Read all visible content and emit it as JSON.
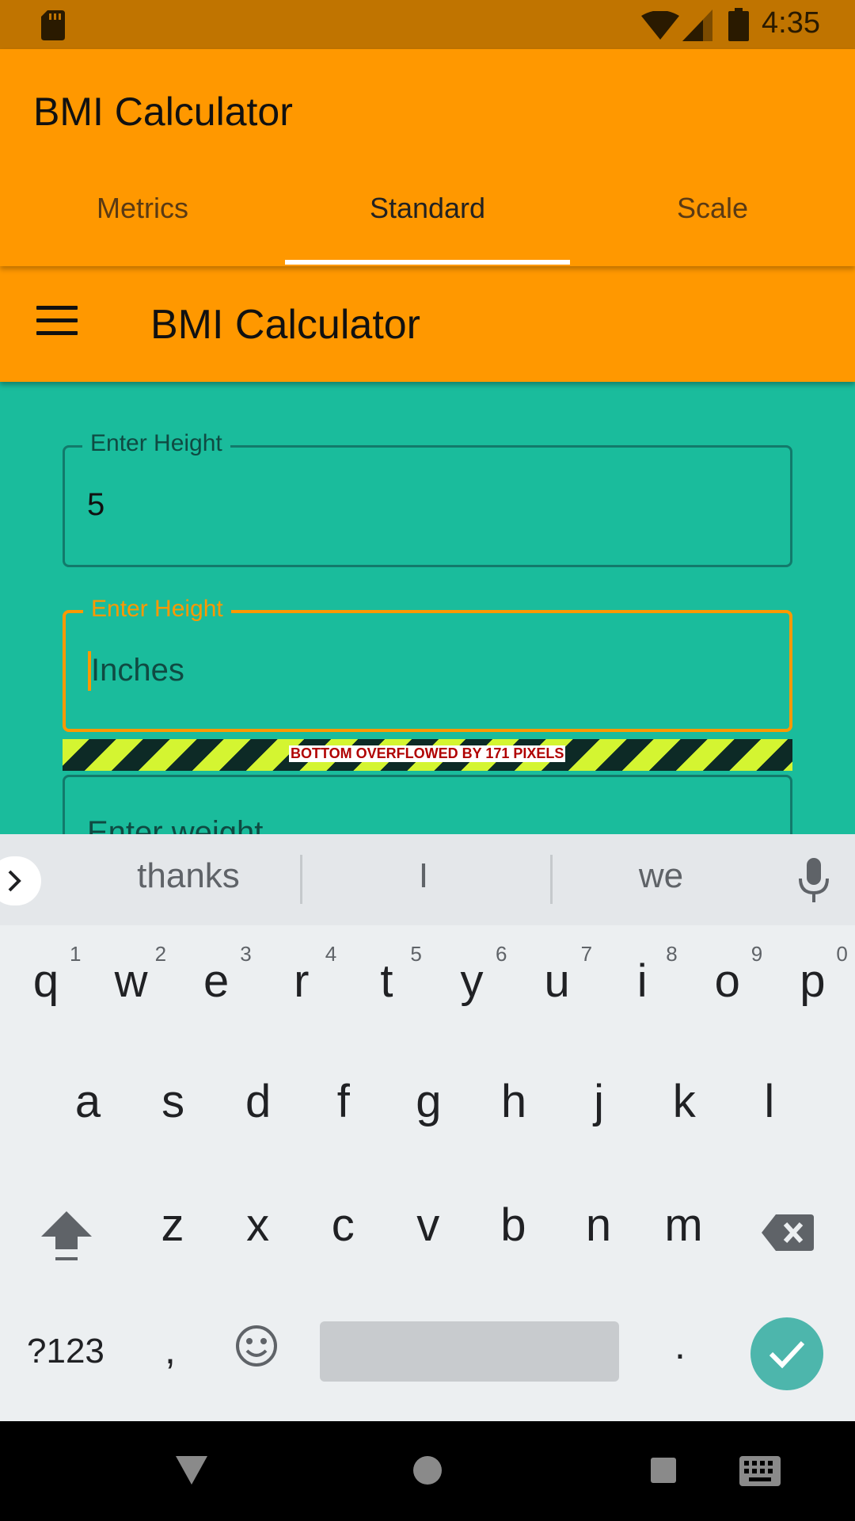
{
  "status_bar": {
    "time": "4:35",
    "icons": [
      "sd-card-icon",
      "wifi-icon",
      "signal-icon",
      "battery-icon"
    ]
  },
  "app_bar": {
    "title": "BMI Calculator",
    "tabs": [
      {
        "label": "Metrics",
        "selected": false
      },
      {
        "label": "Standard",
        "selected": true
      },
      {
        "label": "Scale",
        "selected": false
      }
    ]
  },
  "toolbar": {
    "title": "BMI Calculator",
    "menu_icon": "menu-icon"
  },
  "form": {
    "height_feet": {
      "label": "Enter Height",
      "value": "5"
    },
    "height_inches": {
      "label": "Enter Height",
      "placeholder": "Inches",
      "focused": true
    },
    "weight": {
      "placeholder": "Enter weight"
    }
  },
  "debug": {
    "overflow_message": "BOTTOM OVERFLOWED BY 171 PIXELS"
  },
  "keyboard": {
    "suggestions": [
      "thanks",
      "I",
      "we"
    ],
    "row1": [
      "q",
      "w",
      "e",
      "r",
      "t",
      "y",
      "u",
      "i",
      "o",
      "p"
    ],
    "row1_hints": [
      "1",
      "2",
      "3",
      "4",
      "5",
      "6",
      "7",
      "8",
      "9",
      "0"
    ],
    "row2": [
      "a",
      "s",
      "d",
      "f",
      "g",
      "h",
      "j",
      "k",
      "l"
    ],
    "row3": [
      "z",
      "x",
      "c",
      "v",
      "b",
      "n",
      "m"
    ],
    "symbols_label": "?123",
    "comma": ",",
    "period": "."
  },
  "colors": {
    "app_bar": "#ff9800",
    "background": "#1abc9c",
    "focus": "#ff9800",
    "status_bar": "#c07400"
  }
}
